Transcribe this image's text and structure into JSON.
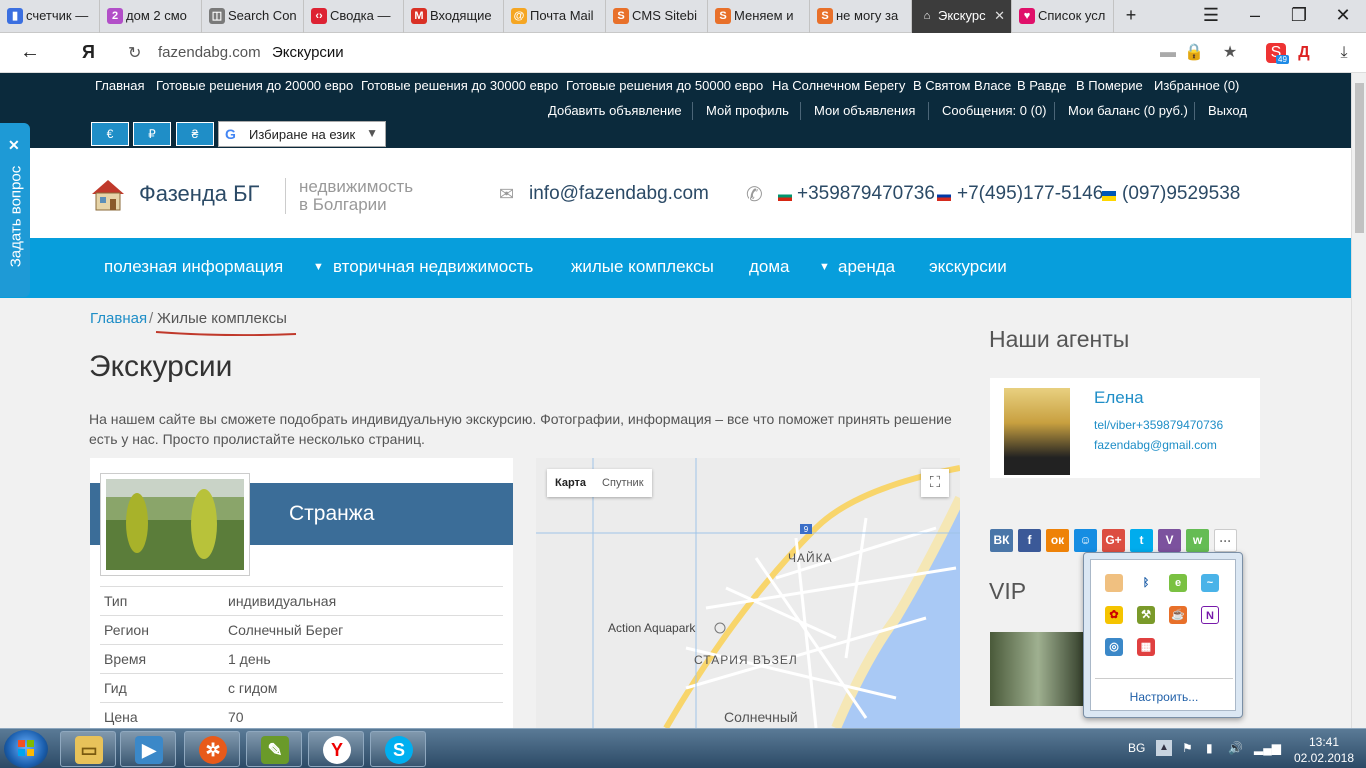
{
  "browser": {
    "tabs": [
      {
        "title": "счетчик —",
        "fav": "▮",
        "color": "#3b6fe0"
      },
      {
        "title": "дом 2 смо",
        "fav": "2",
        "color": "#b24fc8"
      },
      {
        "title": "Search Con",
        "fav": "◫",
        "color": "#7a7a7a"
      },
      {
        "title": "Сводка —",
        "fav": "‹›",
        "color": "#d23"
      },
      {
        "title": "Входящие",
        "fav": "M",
        "color": "#d93025"
      },
      {
        "title": "Почта Mail",
        "fav": "@",
        "color": "#f5a623"
      },
      {
        "title": "CMS Sitebi",
        "fav": "S",
        "color": "#e8702a"
      },
      {
        "title": "Меняем и",
        "fav": "S",
        "color": "#e8702a"
      },
      {
        "title": "не могу за",
        "fav": "S",
        "color": "#e8702a"
      },
      {
        "title": "Экскурс",
        "fav": "⌂",
        "color": "#3c3c3c"
      },
      {
        "title": "Список усл",
        "fav": "♥",
        "color": "#e0106a"
      }
    ],
    "address_host": "fazendabg.com",
    "address_title": "Экскурсии",
    "yandex_label": "Я",
    "badge_count": "49"
  },
  "topnav": {
    "row1": [
      "Главная",
      "Готовые решения до 20000 евро",
      "Готовые решения до 30000 евро",
      "Готовые решения до 50000 евро",
      "На Солнечном Берегу",
      "В Святом Власе",
      "В Равде",
      "В Померие",
      "Избранное (0)"
    ],
    "row2": [
      "Добавить объявление",
      "Мой профиль",
      "Мои объявления",
      "Сообщения: 0 (0)",
      "Мои баланс (0 руб.)",
      "Выход"
    ],
    "currencies": [
      "€",
      "₽",
      "₴"
    ],
    "lang_select": "Избиране на език"
  },
  "header": {
    "brand": "Фазенда БГ",
    "tagline1": "недвижимость",
    "tagline2": "в Болгарии",
    "email": "info@fazendabg.com",
    "phones": [
      "+359879470736",
      "+7(495)177-5146",
      "(097)9529538"
    ]
  },
  "mainnav": [
    "полезная информация",
    "вторичная недвижимость",
    "жилые комплексы",
    "дома",
    "аренда",
    "экскурсии"
  ],
  "ask_button": "Задать вопрос",
  "breadcrumb": {
    "home": "Главная",
    "sep": "/",
    "current": "Жилые комплексы"
  },
  "page_title": "Экскурсии",
  "intro": "На нашем сайте вы сможете подобрать индивидуальную экскурсию. Фотографии, информация – все что поможет принять решение есть у нас. Просто пролистайте несколько страниц.",
  "card": {
    "title": "Странжа",
    "rows": [
      {
        "k": "Тип",
        "v": "индивидуальная"
      },
      {
        "k": "Регион",
        "v": "Солнечный Берег"
      },
      {
        "k": "Время",
        "v": "1 день"
      },
      {
        "k": "Гид",
        "v": "с гидом"
      },
      {
        "k": "Цена",
        "v": "70"
      }
    ]
  },
  "map": {
    "btn_map": "Карта",
    "btn_sat": "Спутник",
    "labels": {
      "chayka": "ЧАЙКА",
      "aquapark": "Action Aquapark",
      "old_town": "СТАРИЯ ВЪЗЕЛ",
      "sunny": "Солнечный",
      "road": "9"
    }
  },
  "agents": {
    "heading": "Наши агенты",
    "name": "Елена",
    "phone": "tel/viber+359879470736",
    "email": "fazendabg@gmail.com"
  },
  "social": [
    "ВК",
    "f",
    "ок",
    "☺",
    "G+",
    "t",
    "V",
    "w",
    "···"
  ],
  "vip_heading": "VIP",
  "tray_popup": {
    "configure": "Настроить..."
  },
  "taskbar": {
    "lang": "BG",
    "time": "13:41",
    "date": "02.02.2018"
  }
}
